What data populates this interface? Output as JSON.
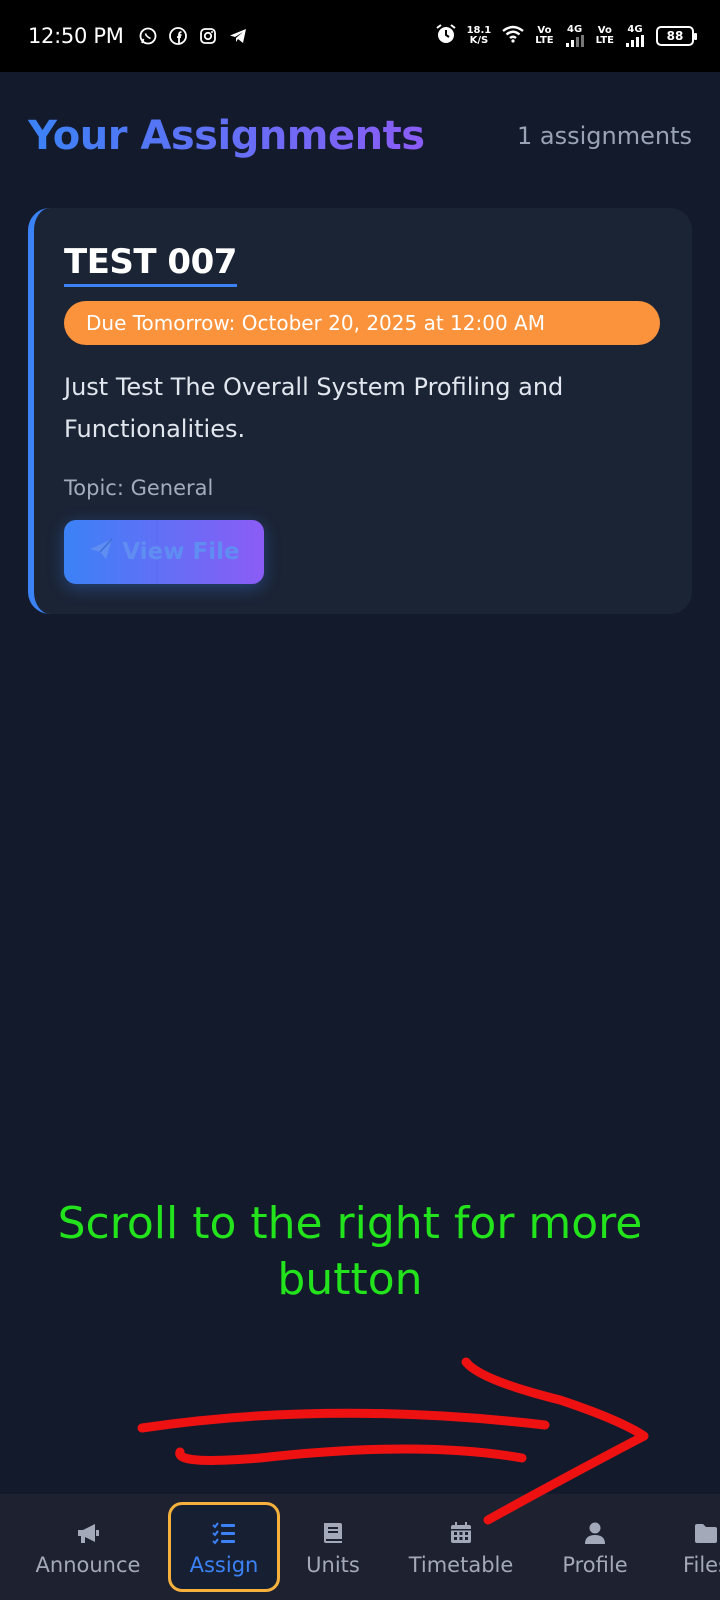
{
  "status_bar": {
    "time": "12:50 PM",
    "speed_value": "18.1",
    "speed_unit": "K/S",
    "sim1_top": "Vo",
    "sim1_bottom": "LTE",
    "sim1_net": "4G",
    "sim2_top": "Vo",
    "sim2_bottom": "LTE",
    "sim2_net": "4G",
    "battery": "88",
    "app_icons": [
      "whatsapp-icon",
      "facebook-icon",
      "instagram-icon",
      "telegram-icon"
    ],
    "system_icons": [
      "alarm-icon",
      "wifi-icon",
      "signal-icon",
      "battery-icon"
    ]
  },
  "header": {
    "title": "Your Assignments",
    "count": "1 assignments"
  },
  "assignments": [
    {
      "title": "TEST 007",
      "due": "Due Tomorrow: October 20, 2025 at 12:00 AM",
      "description": "Just Test The Overall System Profiling and Functionalities.",
      "topic": "Topic: General",
      "button_label": "View File"
    }
  ],
  "annotation": {
    "text_line1": "Scroll to the right for more",
    "text_line2": "button"
  },
  "bottom_nav": {
    "items": [
      {
        "label": "Announce",
        "icon": "megaphone-icon",
        "active": false
      },
      {
        "label": "Assign",
        "icon": "checklist-icon",
        "active": true
      },
      {
        "label": "Units",
        "icon": "book-icon",
        "active": false
      },
      {
        "label": "Timetable",
        "icon": "calendar-icon",
        "active": false
      },
      {
        "label": "Profile",
        "icon": "user-icon",
        "active": false
      },
      {
        "label": "Files",
        "icon": "folder-icon",
        "active": false
      }
    ]
  },
  "colors": {
    "background": "#131a2b",
    "card": "#1b2435",
    "accent_blue": "#3b82f6",
    "accent_purple": "#8b5cf6",
    "due_badge": "#fb923c",
    "annotation_green": "#22e31c",
    "annotation_red": "#ee1111",
    "active_nav_border": "#f5b13c"
  }
}
